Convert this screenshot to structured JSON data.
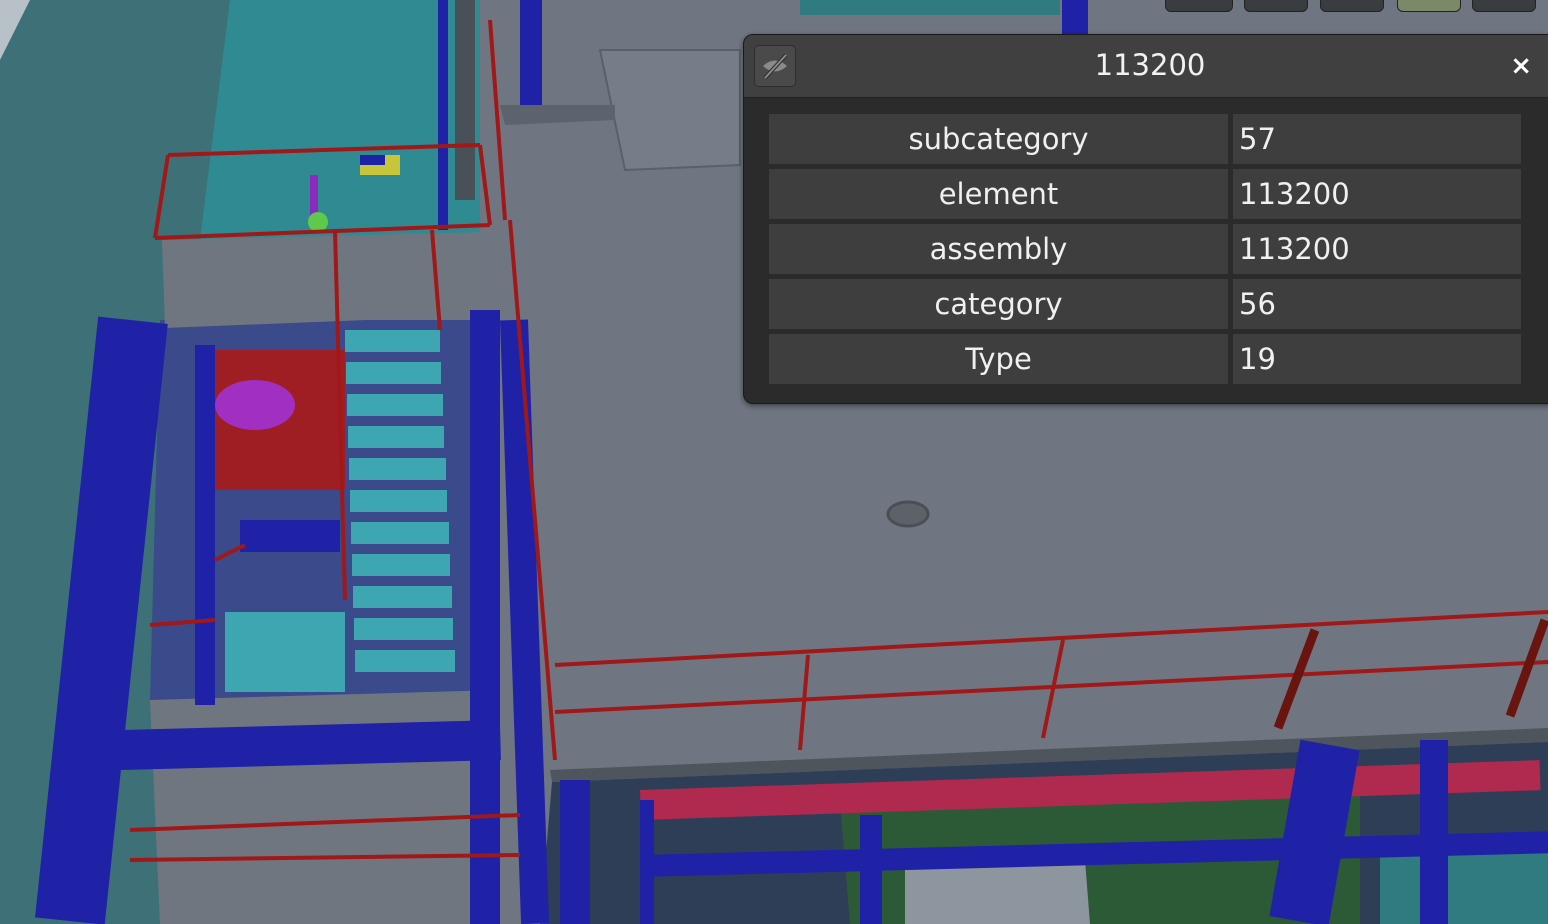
{
  "scene": {
    "description_icon": "3d-viewport"
  },
  "toolbar": {
    "icons": [
      "toolbar-button-icon",
      "toolbar-button-icon",
      "eye-icon",
      "terrain-icon",
      "user-icon"
    ]
  },
  "panel": {
    "title": "113200",
    "toggle_icon": "eye-slash-icon",
    "close_label": "×",
    "properties": [
      {
        "key": "subcategory",
        "value": "57"
      },
      {
        "key": "element",
        "value": "113200"
      },
      {
        "key": "assembly",
        "value": "113200"
      },
      {
        "key": "category",
        "value": "56"
      },
      {
        "key": "Type",
        "value": "19"
      }
    ]
  },
  "colors": {
    "deck": "#6f7681",
    "steel_blue": "#1f22a6",
    "railing_red": "#a01818",
    "stair_cyan": "#3ea6b0",
    "water_teal": "#2f8a92",
    "pipe_magenta": "#b0294f",
    "panel_bg": "#2b2b2b",
    "panel_row": "#3e3e3e"
  }
}
